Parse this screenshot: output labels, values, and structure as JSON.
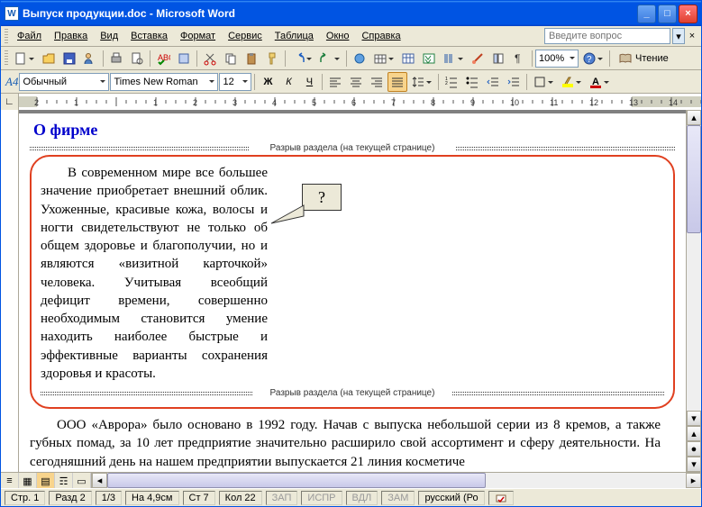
{
  "window": {
    "title": "Выпуск продукции.doc - Microsoft Word"
  },
  "menu": {
    "file": "Файл",
    "edit": "Правка",
    "view": "Вид",
    "insert": "Вставка",
    "format": "Формат",
    "tools": "Сервис",
    "table": "Таблица",
    "window": "Окно",
    "help": "Справка",
    "help_placeholder": "Введите вопрос"
  },
  "toolbar": {
    "zoom": "100%",
    "reading": "Чтение"
  },
  "format": {
    "style_icon": "A4",
    "style": "Обычный",
    "font": "Times New Roman",
    "size": "12",
    "bold": "Ж",
    "italic": "К",
    "underline": "Ч"
  },
  "ruler": {
    "labels": [
      "2",
      "1",
      "",
      "1",
      "2",
      "3",
      "4",
      "5",
      "6",
      "7",
      "8",
      "9",
      "10",
      "11",
      "12",
      "13",
      "14"
    ]
  },
  "document": {
    "heading": "О фирме",
    "section_break": "Разрыв раздела (на текущей странице)",
    "para1": "В современном мире все большее значение приобретает внешний облик. Ухоженные, красивые кожа, волосы и ногти свидетельствуют не только об общем здоровье и благополучии, но и являются «визитной карточ­кой» человека. Учитывая всеоб­щий дефицит времени, совер­шенно необходимым становится умение находить наиболее быст­рые и эффективные варианты со­хранения здоровья и красоты.",
    "para2": "ООО «Аврора» было основано в 1992 году. Начав с выпуска не­большой серии из 8 кремов, а также губных помад, за 10 лет предприятие значительно расширило свой ассортимент и сферу деятельности. На сего­дняшний день на нашем предприятии выпускается 21 линия косметиче­",
    "callout": "?"
  },
  "status": {
    "page": "Стр. 1",
    "section": "Разд 2",
    "pages": "1/3",
    "at": "На 4,9см",
    "line": "Ст 7",
    "col": "Кол 22",
    "rec": "ЗАП",
    "trk": "ИСПР",
    "ext": "ВДЛ",
    "ovr": "ЗАМ",
    "lang": "русский (Ро"
  }
}
